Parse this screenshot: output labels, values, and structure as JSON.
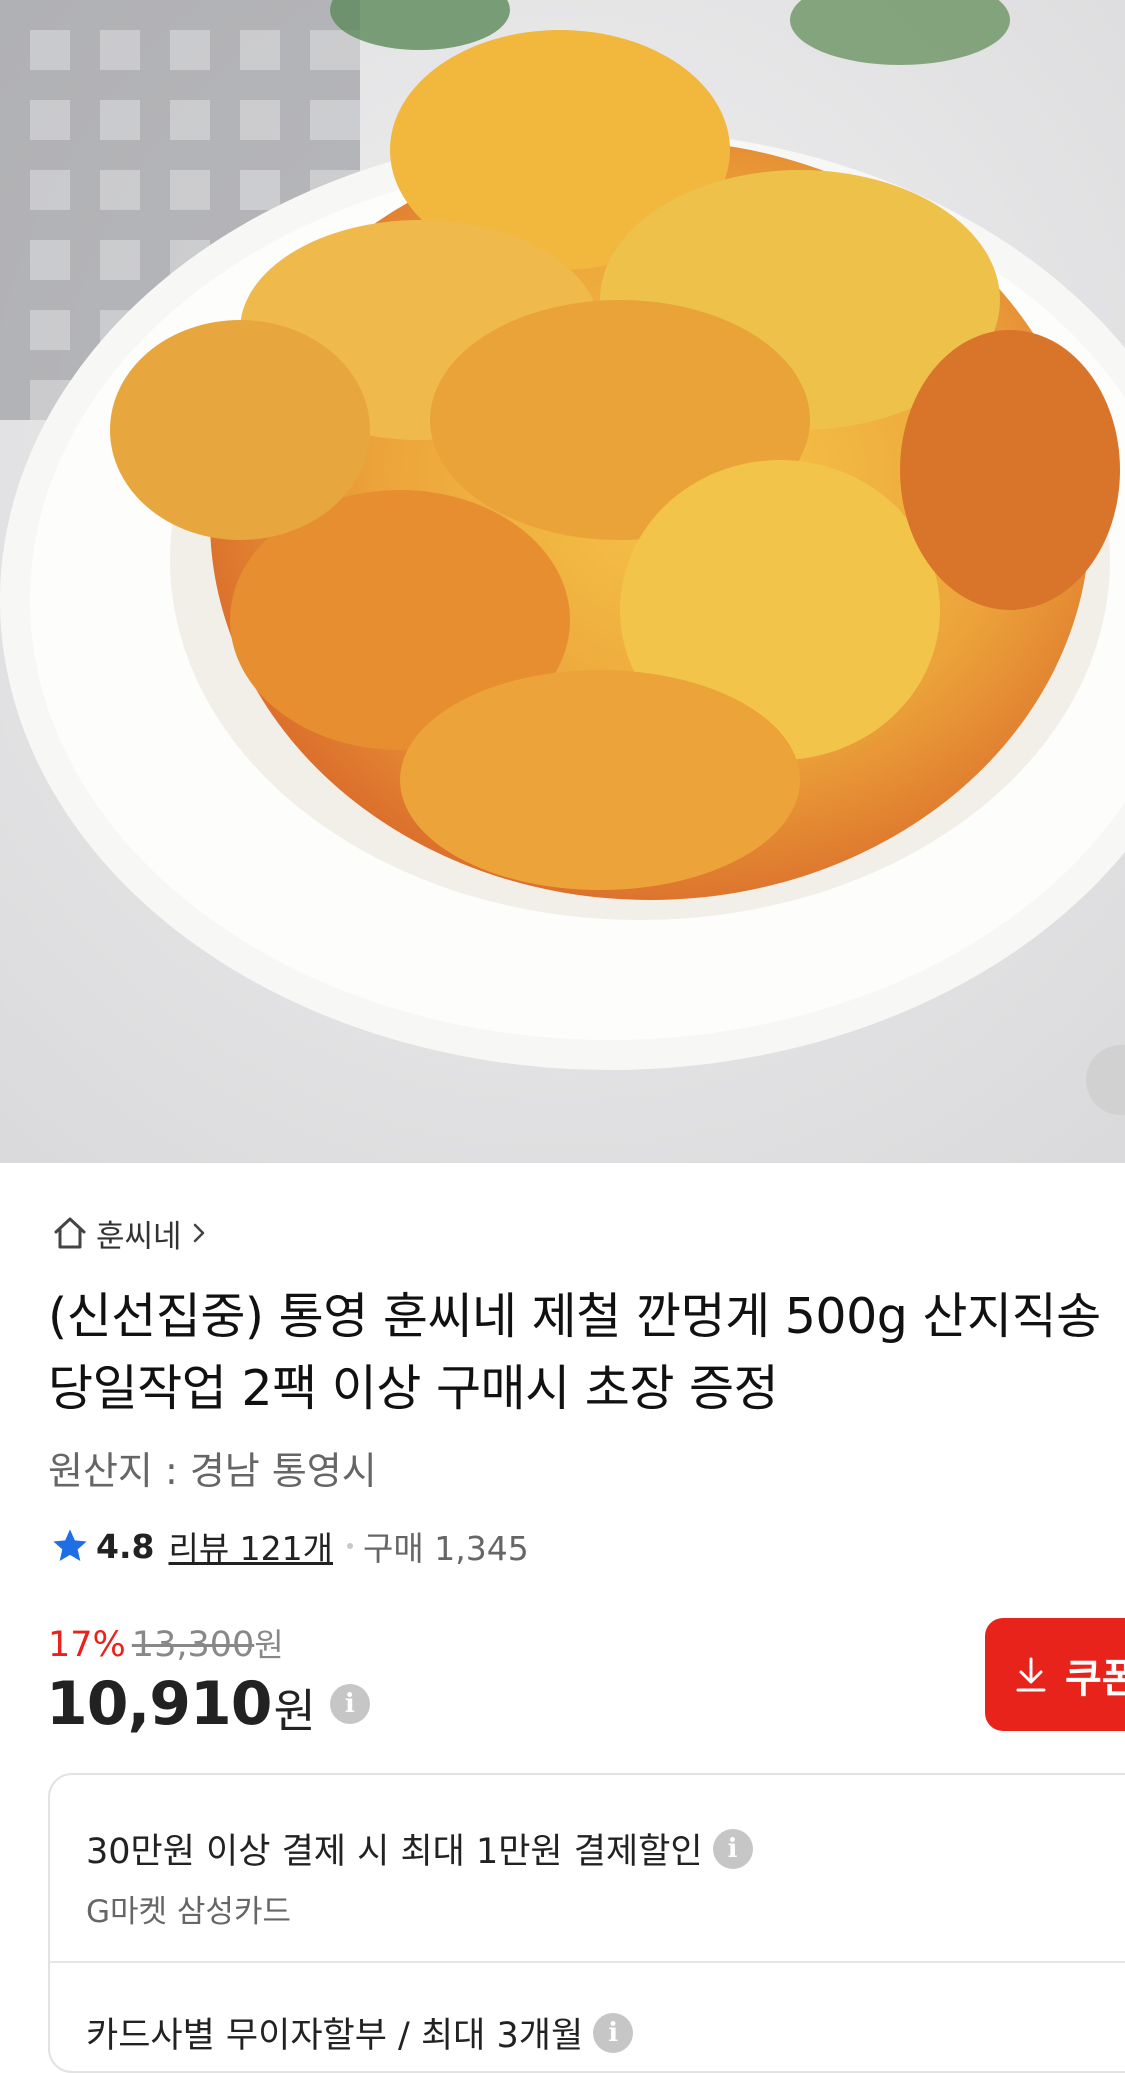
{
  "hero": {
    "image_alt": "product-photo",
    "colors": {
      "bowl": "#fbfbfa",
      "food": "#f0b640",
      "sauce": "#e2752a"
    }
  },
  "seller": {
    "name": "훈씨네",
    "icon": "home-icon",
    "chevron": "chevron-right-icon"
  },
  "product": {
    "title": "(신선집중) 통영 훈씨네 제철 깐멍게 500g 산지직송 당일작업 2팩 이상 구매시 초장 증정",
    "origin": "원산지 : 경남 통영시"
  },
  "rating": {
    "score": "4.8",
    "review_label": "리뷰 121개",
    "purchase_label": "구매 1,345",
    "star_color": "#1e6fe6"
  },
  "pricing": {
    "discount_rate": "17%",
    "original_price": "13,300",
    "original_unit": "원",
    "price": "10,910",
    "unit": "원",
    "info_glyph": "i",
    "accent_color": "#e8231b"
  },
  "coupon": {
    "label": "쿠폰",
    "icon": "download-icon"
  },
  "benefits": [
    {
      "title": "30만원 이상 결제 시 최대 1만원 결제할인",
      "subtitle": "G마켓 삼성카드",
      "info_glyph": "i"
    },
    {
      "title": "카드사별 무이자할부 / 최대 3개월",
      "info_glyph": "i"
    }
  ]
}
